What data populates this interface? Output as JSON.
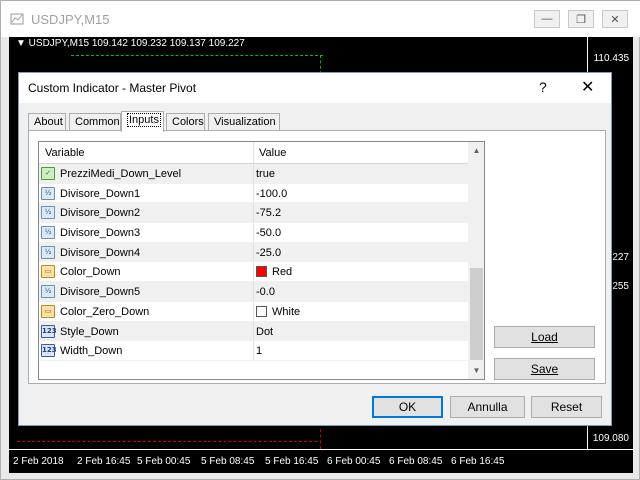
{
  "window": {
    "title": "USDJPY,M15",
    "min_icon": "minimize-icon",
    "max_icon": "maximize-icon",
    "close_icon": "close-icon"
  },
  "chart": {
    "header": "▼ USDJPY,M15  109.142 109.232 109.137 109.227",
    "prices": [
      "110.435",
      "227",
      "255",
      "109.080"
    ],
    "times": [
      "2 Feb 2018",
      "2 Feb 16:45",
      "5 Feb 00:45",
      "5 Feb 08:45",
      "5 Feb 16:45",
      "6 Feb 00:45",
      "6 Feb 08:45",
      "6 Feb 16:45"
    ]
  },
  "dialog": {
    "title": "Custom Indicator - Master Pivot",
    "help": "?",
    "close": "✕",
    "tabs": [
      "About",
      "Common",
      "Inputs",
      "Colors",
      "Visualization"
    ],
    "active_tab": "Inputs",
    "table": {
      "headers": {
        "variable": "Variable",
        "value": "Value"
      },
      "rows": [
        {
          "type": "bool",
          "icon": "bool-icon",
          "variable": "PrezziMedi_Down_Level",
          "value": "true"
        },
        {
          "type": "double",
          "icon": "double-icon",
          "variable": "Divisore_Down1",
          "value": "-100.0"
        },
        {
          "type": "double",
          "icon": "double-icon",
          "variable": "Divisore_Down2",
          "value": "-75.2"
        },
        {
          "type": "double",
          "icon": "double-icon",
          "variable": "Divisore_Down3",
          "value": "-50.0"
        },
        {
          "type": "double",
          "icon": "double-icon",
          "variable": "Divisore_Down4",
          "value": "-25.0"
        },
        {
          "type": "color",
          "icon": "color-icon",
          "variable": "Color_Down",
          "value": "Red",
          "swatch": "#ff0000"
        },
        {
          "type": "double",
          "icon": "double-icon",
          "variable": "Divisore_Down5",
          "value": "-0.0"
        },
        {
          "type": "color",
          "icon": "color-icon",
          "variable": "Color_Zero_Down",
          "value": "White",
          "swatch": "#ffffff"
        },
        {
          "type": "int",
          "icon": "int-icon",
          "variable": "Style_Down",
          "value": "Dot"
        },
        {
          "type": "int",
          "icon": "int-icon",
          "variable": "Width_Down",
          "value": "1"
        }
      ]
    },
    "buttons": {
      "load": "Load",
      "save": "Save",
      "ok": "OK",
      "cancel": "Annulla",
      "reset": "Reset"
    }
  }
}
